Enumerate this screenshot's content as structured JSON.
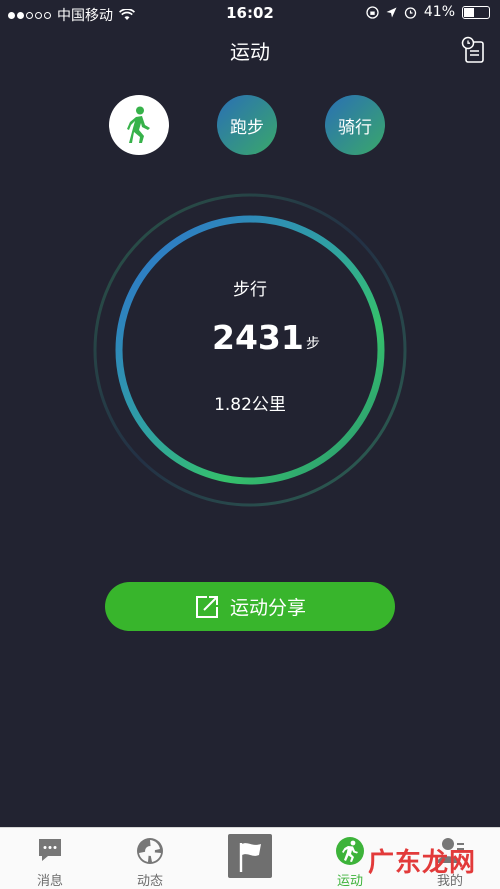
{
  "status_bar": {
    "carrier": "中国移动",
    "time": "16:02",
    "battery": "41%",
    "battery_level": 0.41
  },
  "header": {
    "title": "运动"
  },
  "modes": [
    {
      "label": "",
      "icon": "walking-person-icon",
      "selected": true
    },
    {
      "label": "跑步",
      "selected": false
    },
    {
      "label": "骑行",
      "selected": false
    }
  ],
  "summary": {
    "activity": "步行",
    "steps": "2431",
    "steps_unit": "步",
    "distance": "1.82公里"
  },
  "share": {
    "label": "运动分享",
    "icon": "share-icon"
  },
  "tabs": [
    {
      "label": "消息",
      "icon": "message-icon"
    },
    {
      "label": "动态",
      "icon": "moments-icon"
    },
    {
      "label": "",
      "icon": "flag-icon"
    },
    {
      "label": "运动",
      "icon": "running-icon",
      "active": true
    },
    {
      "label": "我的",
      "icon": "profile-icon"
    }
  ],
  "watermark": "广东龙网",
  "colors": {
    "background": "#222331",
    "accent_green": "#38b52c",
    "ring_blue": "#2e72c9",
    "ring_green": "#34b870"
  }
}
